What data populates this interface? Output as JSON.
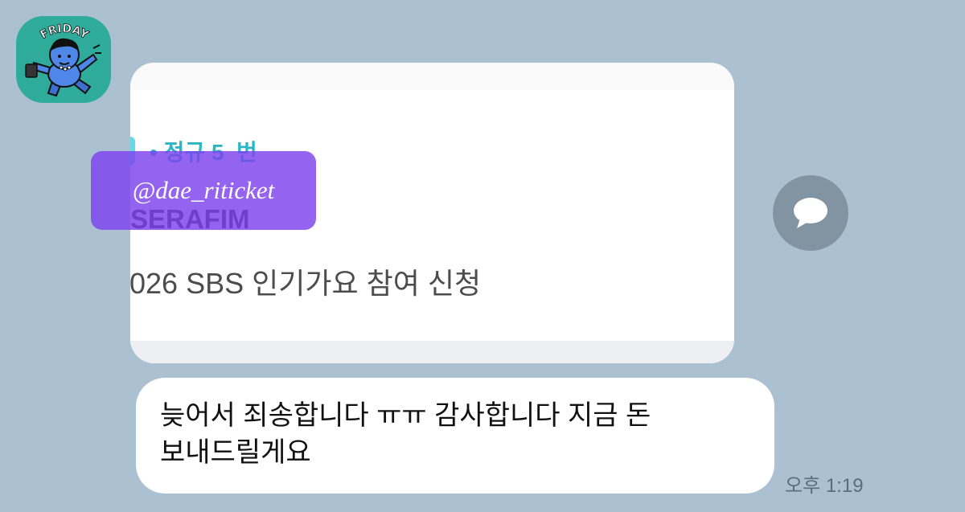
{
  "chat": {
    "avatar": {
      "icon": "character-avatar-icon",
      "sticker_text": "FRIDAY",
      "background_color": "#2eab9a"
    },
    "image_message": {
      "seat_info": "• 정규 5  번",
      "performer": "SERAFIM",
      "event_title": "026 SBS 인기가요 참여 신청",
      "watermark": "@dae_riticket",
      "watermark_color": "#7d42ee",
      "accent_color": "#2bb6c8"
    },
    "share_button": {
      "icon": "speech-bubble-icon"
    },
    "text_message": {
      "line1": "늦어서 죄송합니다 ㅠㅠ 감사합니다 지금 돈",
      "line2": "보내드릴게요"
    },
    "timestamp": "오후 1:19",
    "background_color": "#abc1d1"
  }
}
